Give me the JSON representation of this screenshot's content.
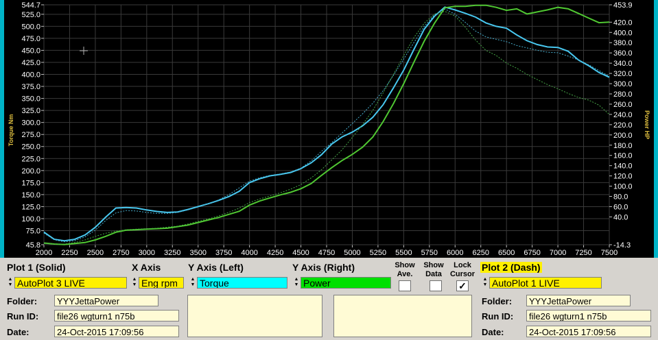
{
  "chart_data": {
    "type": "line",
    "x_ticks": [
      2000,
      2250,
      2500,
      2750,
      3000,
      3250,
      3500,
      3750,
      4000,
      4250,
      4500,
      4750,
      5000,
      5250,
      5500,
      5750,
      6000,
      6250,
      6500,
      6750,
      7000,
      7250,
      7500
    ],
    "y_left_ticks": [
      "544.7",
      "525.0",
      "500.0",
      "475.0",
      "450.0",
      "425.0",
      "400.0",
      "375.0",
      "350.0",
      "325.0",
      "300.0",
      "275.0",
      "250.0",
      "225.0",
      "200.0",
      "175.0",
      "150.0",
      "125.0",
      "100.0",
      "75.0",
      "45.8"
    ],
    "y_right_ticks": [
      "453.9",
      "420.0",
      "400.0",
      "380.0",
      "360.0",
      "340.0",
      "320.0",
      "300.0",
      "280.0",
      "260.0",
      "240.0",
      "220.0",
      "200.0",
      "180.0",
      "160.0",
      "140.0",
      "120.0",
      "100.0",
      "80.0",
      "60.0",
      "40.0",
      "-14.3"
    ],
    "ylabel_left": "Torque Nm",
    "ylabel_right": "Power HP",
    "xlim": [
      2000,
      7500
    ],
    "ylim_left": [
      45.8,
      544.7
    ],
    "ylim_right": [
      -14.3,
      453.9
    ],
    "grid": true,
    "series": [
      {
        "name": "Torque",
        "axis": "left",
        "style": "solid",
        "color": "#48c8f0",
        "x": [
          2000,
          2100,
          2200,
          2300,
          2400,
          2500,
          2600,
          2700,
          2800,
          2900,
          3000,
          3100,
          3200,
          3300,
          3400,
          3500,
          3600,
          3700,
          3800,
          3900,
          4000,
          4100,
          4200,
          4300,
          4400,
          4500,
          4600,
          4700,
          4800,
          4900,
          5000,
          5100,
          5200,
          5300,
          5400,
          5500,
          5600,
          5700,
          5800,
          5900,
          6000,
          6100,
          6200,
          6300,
          6400,
          6500,
          6600,
          6700,
          6800,
          6900,
          7000,
          7100,
          7200,
          7300,
          7400,
          7500
        ],
        "y": [
          72,
          57,
          54,
          57,
          66,
          82,
          103,
          122,
          123,
          122,
          118,
          115,
          113,
          114,
          119,
          125,
          131,
          138,
          146,
          157,
          175,
          183,
          189,
          192,
          196,
          204,
          216,
          233,
          255,
          270,
          280,
          293,
          311,
          337,
          372,
          409,
          452,
          494,
          521,
          540,
          534,
          527,
          519,
          507,
          500,
          496,
          482,
          470,
          462,
          457,
          456,
          448,
          430,
          418,
          404,
          394
        ]
      },
      {
        "name": "Power",
        "axis": "right",
        "style": "solid",
        "color": "#50c832",
        "x": [
          2000,
          2100,
          2200,
          2300,
          2400,
          2500,
          2600,
          2700,
          2800,
          2900,
          3000,
          3100,
          3200,
          3300,
          3400,
          3500,
          3600,
          3700,
          3800,
          3900,
          4000,
          4100,
          4200,
          4300,
          4400,
          4500,
          4600,
          4700,
          4800,
          4900,
          5000,
          5100,
          5200,
          5300,
          5400,
          5500,
          5600,
          5700,
          5800,
          5900,
          6000,
          6100,
          6200,
          6300,
          6400,
          6500,
          6600,
          6700,
          6800,
          6900,
          7000,
          7100,
          7200,
          7300,
          7400,
          7500
        ],
        "y": [
          -11,
          -13,
          -14,
          -12,
          -10,
          -5,
          2,
          10,
          14,
          15,
          16,
          17,
          18,
          21,
          24,
          29,
          34,
          39,
          45,
          51,
          63,
          71,
          77,
          83,
          88,
          95,
          105,
          121,
          136,
          150,
          162,
          176,
          196,
          226,
          261,
          300,
          342,
          383,
          418,
          448,
          451,
          451,
          453,
          453,
          449,
          443,
          446,
          436,
          440,
          444,
          449,
          446,
          437,
          428,
          419,
          420
        ]
      },
      {
        "name": "",
        "axis": "left",
        "style": "dash",
        "color": "#48b0d0",
        "x": [
          2000,
          2100,
          2200,
          2300,
          2400,
          2500,
          2600,
          2700,
          2800,
          2900,
          3000,
          3100,
          3200,
          3300,
          3400,
          3500,
          3600,
          3700,
          3800,
          3900,
          4000,
          4100,
          4200,
          4300,
          4400,
          4500,
          4600,
          4700,
          4800,
          4900,
          5000,
          5100,
          5200,
          5300,
          5400,
          5500,
          5600,
          5700,
          5800,
          5900,
          6000,
          6100,
          6200,
          6300,
          6400,
          6500,
          6600,
          6700,
          6800,
          6900,
          7000,
          7100,
          7200,
          7300,
          7400,
          7500
        ],
        "y": [
          70,
          56,
          52,
          54,
          62,
          76,
          96,
          112,
          117,
          116,
          113,
          111,
          111,
          113,
          118,
          124,
          131,
          139,
          150,
          164,
          178,
          185,
          190,
          193,
          197,
          205,
          220,
          240,
          258,
          278,
          298,
          318,
          340,
          366,
          398,
          432,
          466,
          500,
          524,
          536,
          525,
          508,
          490,
          478,
          473,
          468,
          460,
          455,
          450,
          446,
          445,
          438,
          430,
          420,
          408,
          396
        ]
      },
      {
        "name": "",
        "axis": "right",
        "style": "dash",
        "color": "#48a848",
        "x": [
          2000,
          2100,
          2200,
          2300,
          2400,
          2500,
          2600,
          2700,
          2800,
          2900,
          3000,
          3100,
          3200,
          3300,
          3400,
          3500,
          3600,
          3700,
          3800,
          3900,
          4000,
          4100,
          4200,
          4300,
          4400,
          4500,
          4600,
          4700,
          4800,
          4900,
          5000,
          5100,
          5200,
          5300,
          5400,
          5500,
          5600,
          5700,
          5800,
          5900,
          6000,
          6100,
          6200,
          6300,
          6400,
          6500,
          6600,
          6700,
          6800,
          6900,
          7000,
          7100,
          7200,
          7300,
          7400,
          7500
        ],
        "y": [
          -12,
          -13,
          -13,
          -10,
          -5,
          2,
          8,
          12,
          15,
          16,
          17,
          18,
          20,
          22,
          26,
          31,
          36,
          42,
          49,
          57,
          68,
          75,
          81,
          87,
          94,
          103,
          116,
          132,
          151,
          171,
          195,
          220,
          248,
          282,
          318,
          355,
          390,
          418,
          436,
          441,
          432,
          410,
          385,
          365,
          355,
          340,
          330,
          318,
          308,
          298,
          290,
          281,
          273,
          268,
          258,
          240
        ]
      }
    ]
  },
  "panel": {
    "plot1_header": "Plot 1 (Solid)",
    "xaxis_header": "X Axis",
    "yleft_header": "Y Axis (Left)",
    "yright_header": "Y Axis (Right)",
    "show_ave_label": [
      "Show",
      "Ave."
    ],
    "show_data_label": [
      "Show",
      "Data"
    ],
    "lock_cursor_label": [
      "Lock",
      "Cursor"
    ],
    "lock_cursor_check": "✓",
    "plot2_header": "Plot 2 (Dash)",
    "plot1_source": "AutoPlot 3 LIVE",
    "xaxis_value": "Eng rpm",
    "yleft_value": "Torque",
    "yright_value": "Power",
    "plot2_source": "AutoPlot 1 LIVE",
    "folder_label": "Folder:",
    "runid_label": "Run ID:",
    "date_label": "Date:",
    "plot1_folder": "YYYJettaPower",
    "plot1_runid": "file26 wgturn1 n75b",
    "plot1_date": "24-Oct-2015  17:09:56",
    "plot2_folder": "YYYJettaPower",
    "plot2_runid": "file26 wgturn1 n75b",
    "plot2_date": "24-Oct-2015  17:09:56",
    "spin_up": "▲",
    "spin_down": "▼"
  },
  "colors": {
    "yellow_field": "#fff000",
    "cyan_field": "#00ffff",
    "green_field": "#00e000",
    "torque_line": "#48c8f0",
    "power_line": "#50c832",
    "frame": "#00b4c8"
  }
}
